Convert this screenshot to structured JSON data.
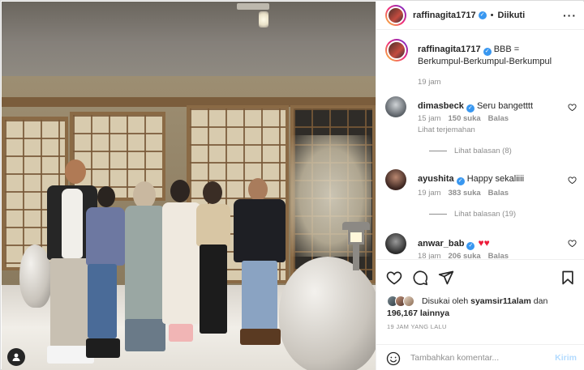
{
  "post": {
    "username": "raffinagita1717",
    "follow_status": "Diikuti",
    "caption": "BBB = Berkumpul-Berkumpul-Berkumpul",
    "caption_time": "19 jam"
  },
  "comments": [
    {
      "username": "dimasbeck",
      "text": "Seru bangetttt",
      "time": "15 jam",
      "likes": "150 suka",
      "reply": "Balas",
      "translate": "Lihat terjemahan",
      "view_replies": "Lihat balasan (8)"
    },
    {
      "username": "ayushita",
      "text": "Happy sekaliiii",
      "time": "19 jam",
      "likes": "383 suka",
      "reply": "Balas",
      "view_replies": "Lihat balasan (19)"
    },
    {
      "username": "anwar_bab",
      "text": "",
      "emoji": "♥♥",
      "time": "18 jam",
      "likes": "206 suka",
      "reply": "Balas"
    }
  ],
  "likes": {
    "prefix": "Disukai oleh",
    "user": "syamsir11alam",
    "joiner": "dan",
    "count": "196,167",
    "suffix": "lainnya"
  },
  "timestamp": "19 JAM YANG LALU",
  "add_comment": {
    "placeholder": "Tambahkan komentar...",
    "post_label": "Kirim"
  },
  "icons": {
    "like": "heart-icon",
    "comment": "comment-icon",
    "share": "send-icon",
    "save": "bookmark-icon",
    "more": "more-options-icon",
    "emoji": "emoji-icon",
    "tagged_user": "user-tag-icon",
    "verified": "verified-badge-icon"
  },
  "colors": {
    "verified": "#3897f0",
    "muted_text": "#8e8e8e",
    "post_button_disabled": "#b3dbff",
    "heart_emoji": "#ed1c3a"
  }
}
